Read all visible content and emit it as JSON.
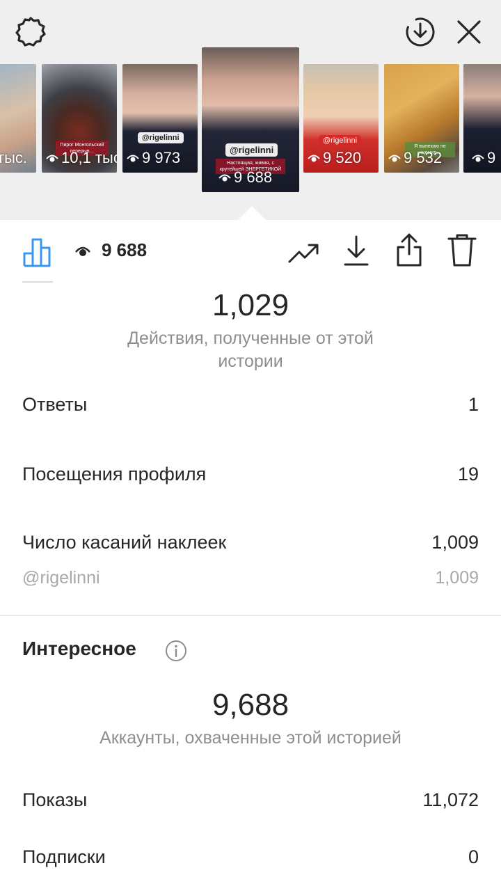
{
  "header": {
    "settings_icon": "gear-icon",
    "download_icon": "download-circle-icon",
    "close_icon": "close-icon"
  },
  "thumbnails": [
    {
      "views": "тыс."
    },
    {
      "views": "10,1 тыс."
    },
    {
      "views": "9 973",
      "sticker": "@rigelinni"
    },
    {
      "views": "9 688",
      "sticker": "@rigelinni",
      "selected": true
    },
    {
      "views": "9 520",
      "sticker": "@rigelinni"
    },
    {
      "views": "9 532"
    },
    {
      "views": "9"
    }
  ],
  "toolbar": {
    "views_count": "9 688",
    "icons": [
      "insights-bar-icon",
      "eye-icon",
      "trending-icon",
      "download-icon",
      "share-icon",
      "trash-icon"
    ]
  },
  "actions": {
    "total": "1,029",
    "caption": "Действия, полученные от этой истории",
    "rows": [
      {
        "label": "Ответы",
        "value": "1"
      },
      {
        "label": "Посещения профиля",
        "value": "19"
      },
      {
        "label": "Число касаний наклеек",
        "value": "1,009"
      }
    ],
    "sub_row": {
      "label": "@rigelinni",
      "value": "1,009"
    }
  },
  "discovery": {
    "title": "Интересное",
    "total": "9,688",
    "caption": "Аккаунты, охваченные этой историей",
    "rows": [
      {
        "label": "Показы",
        "value": "11,072"
      },
      {
        "label": "Подписки",
        "value": "0"
      }
    ]
  }
}
